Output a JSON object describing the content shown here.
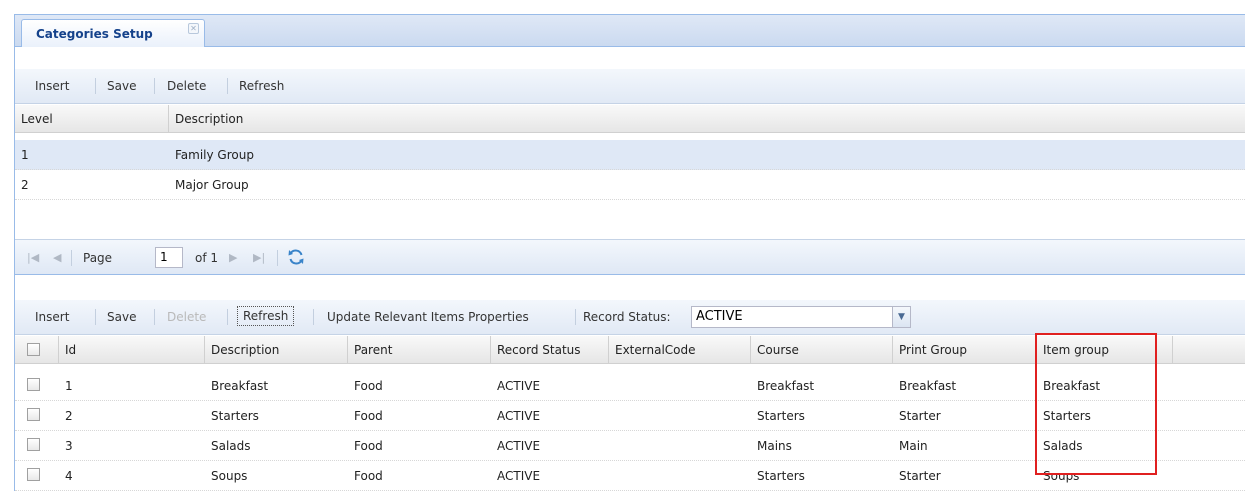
{
  "tab": {
    "title": "Categories Setup",
    "close_glyph": "✕"
  },
  "top_toolbar": {
    "insert": "Insert",
    "save": "Save",
    "delete": "Delete",
    "refresh": "Refresh"
  },
  "levels_grid": {
    "columns": [
      "Level",
      "Description"
    ],
    "rows": [
      {
        "level": "1",
        "description": "Family Group"
      },
      {
        "level": "2",
        "description": "Major Group"
      }
    ]
  },
  "pager": {
    "page_label": "Page",
    "page_value": "1",
    "of_label": "of 1"
  },
  "bottom_toolbar": {
    "insert": "Insert",
    "save": "Save",
    "delete": "Delete",
    "refresh": "Refresh",
    "update_relevant": "Update Relevant Items Properties",
    "record_status_label": "Record Status:",
    "record_status_value": "ACTIVE"
  },
  "categories_grid": {
    "columns": [
      "Id",
      "Description",
      "Parent",
      "Record Status",
      "ExternalCode",
      "Course",
      "Print Group",
      "Item group"
    ],
    "rows": [
      {
        "id": "1",
        "description": "Breakfast",
        "parent": "Food",
        "status": "ACTIVE",
        "external": "",
        "course": "Breakfast",
        "print_group": "Breakfast",
        "item_group": "Breakfast"
      },
      {
        "id": "2",
        "description": "Starters",
        "parent": "Food",
        "status": "ACTIVE",
        "external": "",
        "course": "Starters",
        "print_group": "Starter",
        "item_group": "Starters"
      },
      {
        "id": "3",
        "description": "Salads",
        "parent": "Food",
        "status": "ACTIVE",
        "external": "",
        "course": "Mains",
        "print_group": "Main",
        "item_group": "Salads"
      },
      {
        "id": "4",
        "description": "Soups",
        "parent": "Food",
        "status": "ACTIVE",
        "external": "",
        "course": "Starters",
        "print_group": "Starter",
        "item_group": "Soups"
      }
    ]
  },
  "colors": {
    "highlight": "#e02020",
    "selected_row": "#dfe8f6",
    "tab_title": "#15428b"
  }
}
